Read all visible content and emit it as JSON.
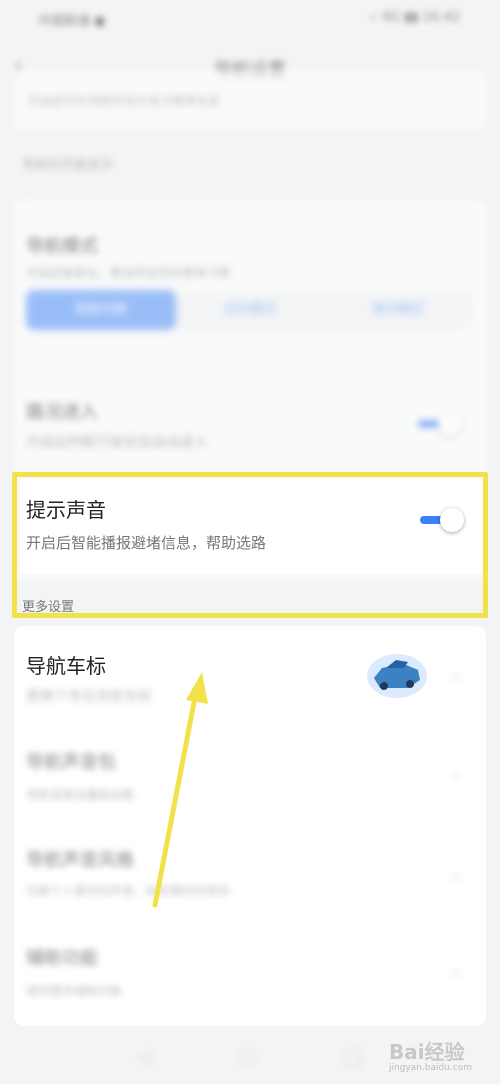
{
  "status_bar": {
    "left": "中国联通 ●",
    "right": "⌁ 4G ▮▮ 16:42"
  },
  "header": {
    "title": "导航设置"
  },
  "top_card": {
    "desc": "开启后可在导航时显示电子眼等信息"
  },
  "section1": {
    "label": "导航时页面显示"
  },
  "auto_mode": {
    "title": "导航模式",
    "desc": "开启后智能化，更加符合您的使用习惯",
    "segments": [
      "智能切换",
      "白天模式",
      "夜间模式"
    ]
  },
  "auto_enter": {
    "title": "路况进入",
    "desc": "开启后判断行驶状态自动进入"
  },
  "sound": {
    "title": "提示声音",
    "desc": "开启后智能播报避堵信息，帮助选路"
  },
  "section2": {
    "label": "更多设置"
  },
  "car_icon": {
    "title": "导航车标",
    "desc": "更换个性化导航车标"
  },
  "voice": {
    "title": "导航声音包",
    "desc": "导航语音包播放设置"
  },
  "voice_style": {
    "title": "导航声音风格",
    "desc": "切换个人喜欢的声音，给你更好的体验"
  },
  "more": {
    "title": "辅助功能",
    "desc": "提供更多辅助功能"
  },
  "watermark": {
    "text": "Bai经验",
    "sub": "jingyan.baidu.com"
  },
  "colors": {
    "accent": "#3b82f6",
    "highlight": "#f2e24a"
  }
}
